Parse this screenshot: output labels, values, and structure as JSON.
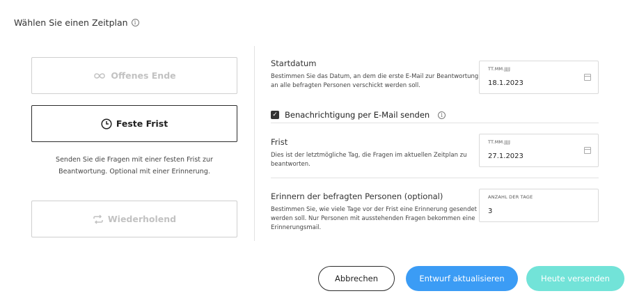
{
  "page": {
    "title": "Wählen Sie einen Zeitplan",
    "info_icon": "info-icon"
  },
  "options": {
    "open_end": {
      "label": "Offenes Ende",
      "icon": "infinity-icon"
    },
    "fixed_deadline": {
      "label": "Feste Frist",
      "icon": "clock-icon",
      "selected": true
    },
    "fixed_description": "Senden Sie die Fragen mit einer festen Frist zur Beantwortung. Optional mit einer Erinnerung.",
    "recurring": {
      "label": "Wiederholend",
      "icon": "repeat-icon"
    }
  },
  "start": {
    "title": "Startdatum",
    "description": "Bestimmen Sie das Datum, an dem die erste E-Mail zur Beantwortung an alle befragten Personen verschickt werden soll.",
    "field_label": "TT.MM.JJJJ",
    "value": "18.1.2023"
  },
  "notification": {
    "label": "Benachrichtigung per E-Mail senden",
    "checked": true
  },
  "deadline": {
    "title": "Frist",
    "description": "Dies ist der letztmögliche Tag, die Fragen im aktuellen Zeitplan zu beantworten.",
    "field_label": "TT.MM.JJJJ",
    "value": "27.1.2023"
  },
  "reminder": {
    "title": "Erinnern der befragten Personen (optional)",
    "description": "Bestimmen Sie, wie viele Tage vor der Frist eine Erinnerung gesendet werden soll. Nur Personen mit ausstehenden Fragen bekommen eine Erinnerungsmail.",
    "field_label": "ANZAHL DER TAGE",
    "value": "3"
  },
  "buttons": {
    "cancel": "Abbrechen",
    "update": "Entwurf aktualisieren",
    "send": "Heute versenden"
  },
  "colors": {
    "primary": "#3b9cf5",
    "send": "#72e3d8",
    "border": "#d9d9d9"
  }
}
